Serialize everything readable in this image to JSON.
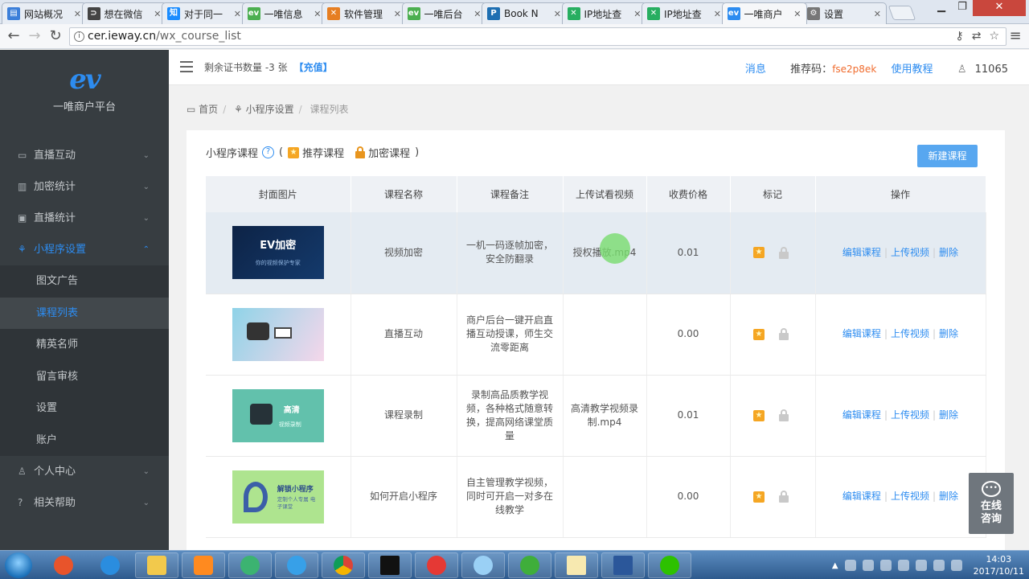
{
  "browser": {
    "tabs": [
      {
        "label": "网站概况",
        "fav_color": "#3c7fd9",
        "fav_glyph": "▤"
      },
      {
        "label": "想在微信",
        "fav_color": "#444444",
        "fav_glyph": "⊃"
      },
      {
        "label": "对于同一",
        "fav_color": "#1a8cff",
        "fav_glyph": "知"
      },
      {
        "label": "一唯信息",
        "fav_color": "#4caf50",
        "fav_glyph": "ev"
      },
      {
        "label": "软件管理",
        "fav_color": "#e67e22",
        "fav_glyph": "✕"
      },
      {
        "label": "一唯后台",
        "fav_color": "#4caf50",
        "fav_glyph": "ev"
      },
      {
        "label": "Book N",
        "fav_color": "#1f6fb2",
        "fav_glyph": "P"
      },
      {
        "label": "IP地址查",
        "fav_color": "#27ae60",
        "fav_glyph": "✕"
      },
      {
        "label": "IP地址查",
        "fav_color": "#27ae60",
        "fav_glyph": "✕"
      },
      {
        "label": "一唯商户",
        "fav_color": "#2d8cf0",
        "fav_glyph": "ev",
        "active": true
      },
      {
        "label": "设置",
        "fav_color": "#777777",
        "fav_glyph": "⚙"
      }
    ],
    "url_host": "cer.ieway.cn",
    "url_path": "/wx_course_list"
  },
  "sidebar": {
    "logo": "ev",
    "brand_name": "一唯商户平台",
    "menu": [
      {
        "label": "直播互动",
        "icon": "▭"
      },
      {
        "label": "加密统计",
        "icon": "▥"
      },
      {
        "label": "直播统计",
        "icon": "▣"
      },
      {
        "label": "小程序设置",
        "icon": "⚘",
        "open": true
      }
    ],
    "submenu": [
      {
        "label": "图文广告"
      },
      {
        "label": "课程列表",
        "active": true
      },
      {
        "label": "精英名师"
      },
      {
        "label": "留言审核"
      },
      {
        "label": "设置"
      },
      {
        "label": "账户"
      }
    ],
    "menu_bottom": [
      {
        "label": "个人中心",
        "icon": "♙"
      },
      {
        "label": "相关帮助",
        "icon": "?"
      }
    ]
  },
  "header": {
    "cert_text": "剩余证书数量 -3 张",
    "recharge": "【充值】",
    "messages": "消息",
    "referral_label": "推荐码：",
    "referral_code": "fse2p8ek",
    "tutorial": "使用教程",
    "user_id": "11065"
  },
  "breadcrumb": {
    "home": "首页",
    "section": "小程序设置",
    "current": "课程列表"
  },
  "panel": {
    "title": "小程序课程",
    "paren_open": "(",
    "recommended": "推荐课程",
    "encrypted": "加密课程",
    "paren_close": ")",
    "new_button": "新建课程",
    "columns": [
      "封面图片",
      "课程名称",
      "课程备注",
      "上传试看视频",
      "收费价格",
      "标记",
      "操作"
    ],
    "op_edit": "编辑课程",
    "op_upload": "上传视频",
    "op_delete": "删除",
    "rows": [
      {
        "cover_title": "EV加密",
        "cover_sub": "你的视频保护专家",
        "name": "视频加密",
        "note": "一机一码逐帧加密，安全防翻录",
        "video": "授权播放.mp4",
        "price": "0.01"
      },
      {
        "cover_title": "",
        "cover_sub": "",
        "name": "直播互动",
        "note": "商户后台一键开启直播互动授课，师生交流零距离",
        "video": "",
        "price": "0.00"
      },
      {
        "cover_title": "高清",
        "cover_sub": "视频录制",
        "name": "课程录制",
        "note": "录制高品质教学视频，各种格式随意转换，提高网络课堂质量",
        "video": "高清教学视频录制.mp4",
        "price": "0.01"
      },
      {
        "cover_title": "解锁小程序",
        "cover_sub": "定制个人专属 电子课堂",
        "name": "如何开启小程序",
        "note": "自主管理教学视频，同时可开启一对多在线教学",
        "video": "",
        "price": "0.00"
      }
    ]
  },
  "chat_widget": {
    "line1": "在线",
    "line2": "咨询"
  },
  "taskbar": {
    "time": "14:03",
    "date": "2017/10/11"
  }
}
